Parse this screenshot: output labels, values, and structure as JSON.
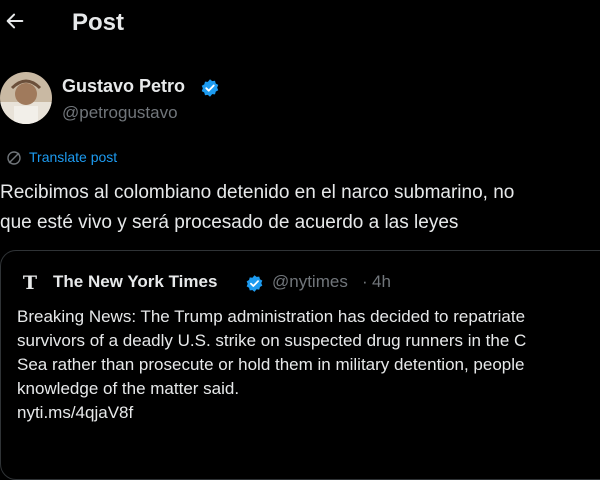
{
  "header": {
    "title": "Post"
  },
  "author": {
    "name": "Gustavo Petro",
    "handle": "@petrogustavo"
  },
  "translate": {
    "label": "Translate post"
  },
  "post": {
    "lines": [
      "Recibimos al colombiano detenido en el narco submarino, no",
      "que esté vivo y será procesado de acuerdo a las leyes"
    ]
  },
  "quoted": {
    "name": "The New York Times",
    "handle": "@nytimes",
    "separator": "·",
    "time": "4h",
    "lines": [
      "Breaking News: The Trump administration has decided to repatriate",
      "survivors of a deadly U.S. strike on suspected drug runners in the C",
      "Sea rather than prosecute or hold them in military detention, people",
      "knowledge of the matter said.",
      "nyti.ms/4qjaV8f"
    ]
  },
  "icons": {
    "back": "arrow-left-icon",
    "verified": "verified-badge-icon",
    "translate": "globe-icon",
    "quote_logo": "nyt-logo-icon"
  },
  "colors": {
    "background": "#000000",
    "text": "#e7e9ea",
    "secondary": "#71767b",
    "accent": "#1d9bf0",
    "border": "#2f3336"
  }
}
